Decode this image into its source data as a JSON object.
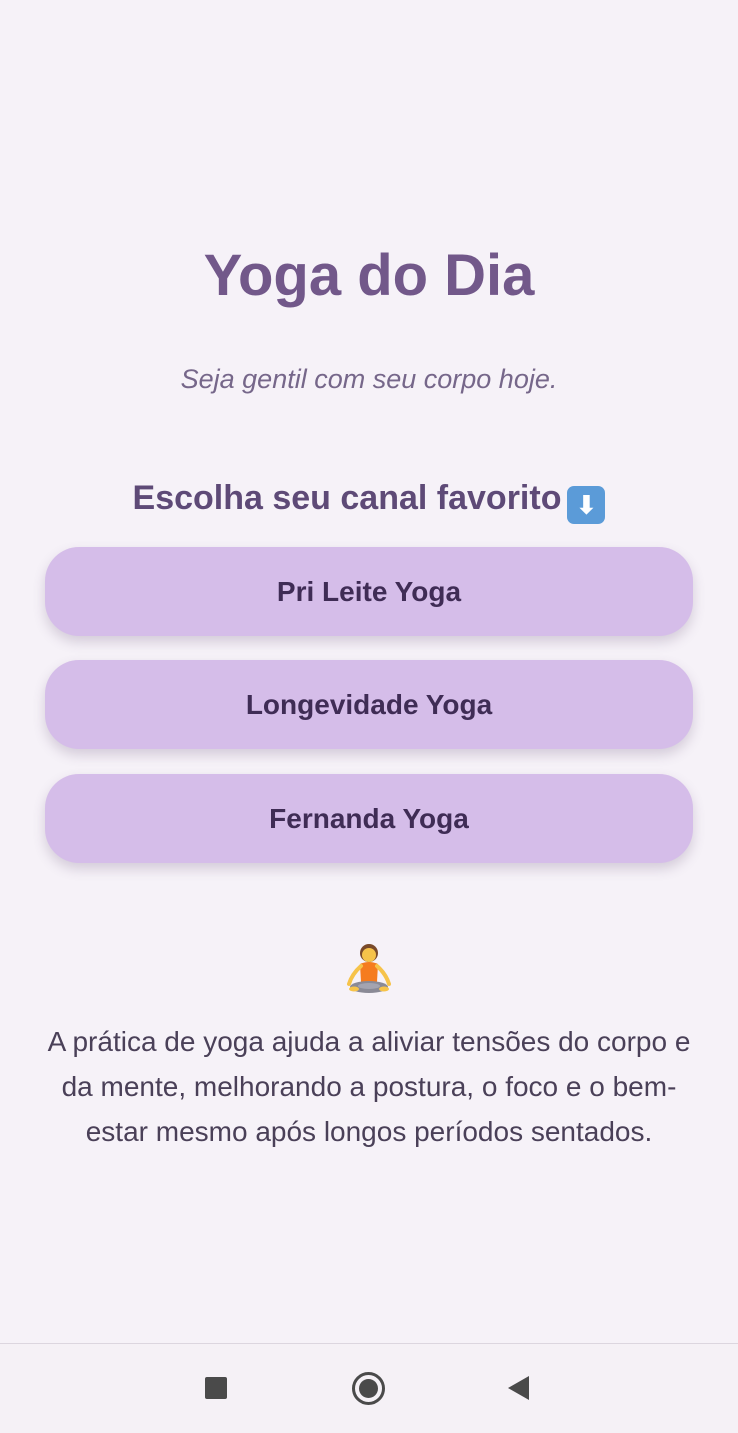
{
  "header": {
    "title": "Yoga do Dia",
    "subtitle": "Seja gentil com seu corpo hoje."
  },
  "channels": {
    "heading": "Escolha seu canal favorito",
    "heading_icon": "down-arrow-icon",
    "items": [
      {
        "label": "Pri Leite Yoga"
      },
      {
        "label": "Longevidade Yoga"
      },
      {
        "label": "Fernanda Yoga"
      }
    ]
  },
  "info": {
    "icon": "person-in-lotus-position-icon",
    "text": "A prática de yoga ajuda a aliviar tensões do corpo e da mente, melhorando a postura, o foco e o bem-estar mesmo após longos períodos sentados."
  },
  "navbar": {
    "icons": [
      "recents-square-icon",
      "home-circle-icon",
      "back-triangle-icon"
    ]
  },
  "colors": {
    "background": "#f6f2f8",
    "title": "#72588a",
    "button_bg": "#d5bde9",
    "button_text": "#3f2c55"
  }
}
